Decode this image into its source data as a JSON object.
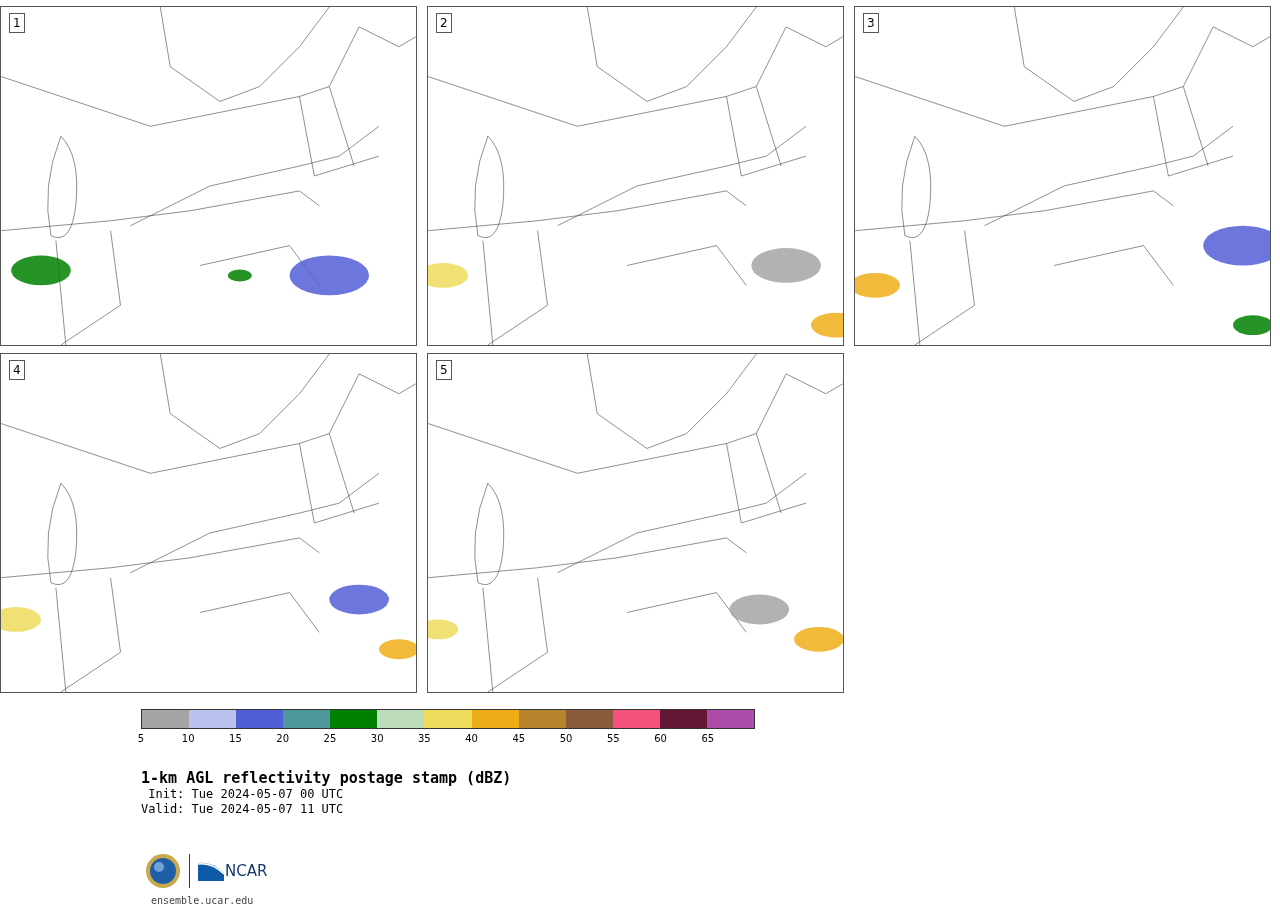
{
  "panels": [
    {
      "number": "1"
    },
    {
      "number": "2"
    },
    {
      "number": "3"
    },
    {
      "number": "4"
    },
    {
      "number": "5"
    }
  ],
  "colorbar": [
    {
      "label": "5",
      "color": "#a5a5a5"
    },
    {
      "label": "10",
      "color": "#b8c2ec"
    },
    {
      "label": "15",
      "color": "#525ed6"
    },
    {
      "label": "20",
      "color": "#4e979b"
    },
    {
      "label": "25",
      "color": "#008000"
    },
    {
      "label": "30",
      "color": "#bddcbc"
    },
    {
      "label": "35",
      "color": "#eedb5b"
    },
    {
      "label": "40",
      "color": "#efae18"
    },
    {
      "label": "45",
      "color": "#b9842e"
    },
    {
      "label": "50",
      "color": "#8b5b3e"
    },
    {
      "label": "55",
      "color": "#f4507c"
    },
    {
      "label": "60",
      "color": "#641734"
    },
    {
      "label": "65",
      "color": "#ad4ba8"
    }
  ],
  "title": "1-km AGL reflectivity postage stamp (dBZ)",
  "init": " Init: Tue 2024-05-07 00 UTC",
  "valid": "Valid: Tue 2024-05-07 11 UTC",
  "logo_text": "NCAR",
  "url": "ensemble.ucar.edu"
}
